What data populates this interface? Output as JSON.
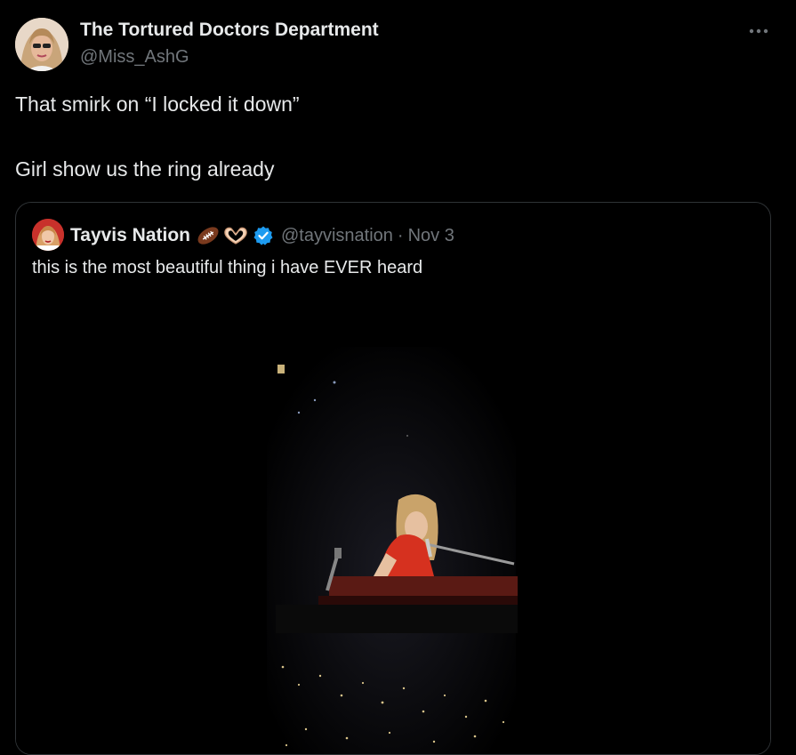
{
  "author": {
    "name": "The Tortured Doctors Department",
    "handle": "@Miss_AshG",
    "avatar_icon": "profile-photo-avatar"
  },
  "more_icon": "more-dots-icon",
  "tweet": {
    "line1": "That smirk on “I locked it down”",
    "line2": "Girl show us the ring already"
  },
  "quote": {
    "name": "Tayvis Nation",
    "emojis": [
      "football-icon",
      "heart-hands-icon"
    ],
    "verified_icon": "verified-badge-icon",
    "handle": "@tayvisnation",
    "separator": "·",
    "date": "Nov 3",
    "text": "this is the most beautiful thing i have EVER heard",
    "media_icon": "concert-video-thumbnail"
  },
  "colors": {
    "background": "#000000",
    "text_primary": "#e7e9ea",
    "text_secondary": "#71767b",
    "border": "#2f3336",
    "verified_blue": "#1d9bf0"
  }
}
